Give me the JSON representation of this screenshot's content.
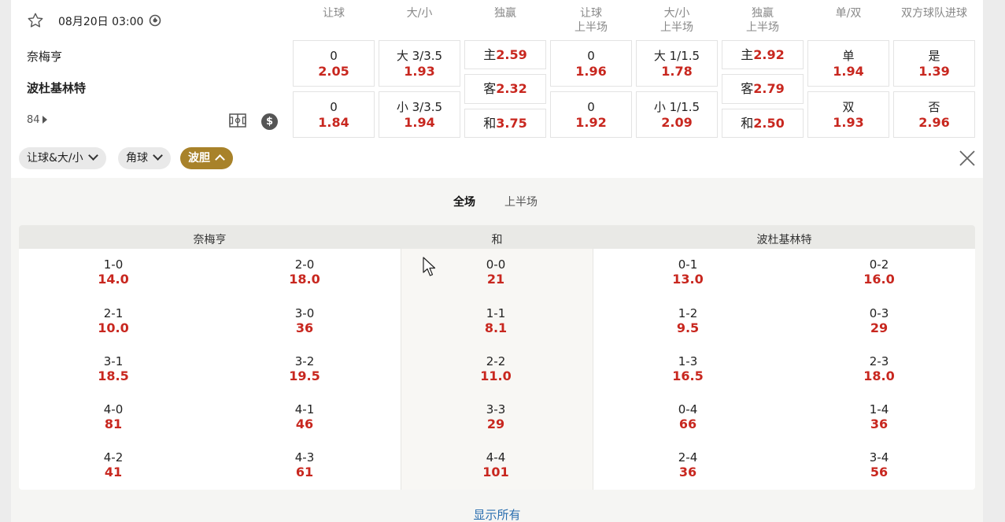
{
  "match": {
    "datetime": "08月20日 03:00",
    "home": "奈梅亨",
    "away": "波杜基林特",
    "minute": "84"
  },
  "market_headers": [
    {
      "line1": "让球",
      "line2": ""
    },
    {
      "line1": "大/小",
      "line2": ""
    },
    {
      "line1": "独赢",
      "line2": ""
    },
    {
      "line1": "让球",
      "line2": "上半场"
    },
    {
      "line1": "大/小",
      "line2": "上半场"
    },
    {
      "line1": "独赢",
      "line2": "上半场"
    },
    {
      "line1": "单/双",
      "line2": ""
    },
    {
      "line1": "双方球队进球",
      "line2": ""
    }
  ],
  "markets": {
    "handicap": [
      {
        "line": "0",
        "odds": "2.05"
      },
      {
        "line": "0",
        "odds": "1.84"
      }
    ],
    "over_under": [
      {
        "line": "大 3/3.5",
        "odds": "1.93"
      },
      {
        "line": "小 3/3.5",
        "odds": "1.94"
      }
    ],
    "win": [
      {
        "label": "主",
        "odds": "2.59"
      },
      {
        "label": "客",
        "odds": "2.32"
      },
      {
        "label": "和",
        "odds": "3.75"
      }
    ],
    "handicap_1h": [
      {
        "line": "0",
        "odds": "1.96"
      },
      {
        "line": "0",
        "odds": "1.92"
      }
    ],
    "over_under_1h": [
      {
        "line": "大 1/1.5",
        "odds": "1.78"
      },
      {
        "line": "小 1/1.5",
        "odds": "2.09"
      }
    ],
    "win_1h": [
      {
        "label": "主",
        "odds": "2.92"
      },
      {
        "label": "客",
        "odds": "2.79"
      },
      {
        "label": "和",
        "odds": "2.50"
      }
    ],
    "odd_even": [
      {
        "label": "单",
        "odds": "1.94"
      },
      {
        "label": "双",
        "odds": "1.93"
      }
    ],
    "btts": [
      {
        "label": "是",
        "odds": "1.39"
      },
      {
        "label": "否",
        "odds": "2.96"
      }
    ]
  },
  "filters": [
    {
      "label": "让球&大/小",
      "active": false
    },
    {
      "label": "角球",
      "active": false
    },
    {
      "label": "波胆",
      "active": true
    }
  ],
  "period_tabs": [
    {
      "label": "全场",
      "active": true
    },
    {
      "label": "上半场",
      "active": false
    }
  ],
  "correct_score": {
    "columns": [
      "奈梅亨",
      "和",
      "波杜基林特"
    ],
    "home": [
      [
        {
          "score": "1-0",
          "odds": "14.0"
        },
        {
          "score": "2-0",
          "odds": "18.0"
        }
      ],
      [
        {
          "score": "2-1",
          "odds": "10.0"
        },
        {
          "score": "3-0",
          "odds": "36"
        }
      ],
      [
        {
          "score": "3-1",
          "odds": "18.5"
        },
        {
          "score": "3-2",
          "odds": "19.5"
        }
      ],
      [
        {
          "score": "4-0",
          "odds": "81"
        },
        {
          "score": "4-1",
          "odds": "46"
        }
      ],
      [
        {
          "score": "4-2",
          "odds": "41"
        },
        {
          "score": "4-3",
          "odds": "61"
        }
      ]
    ],
    "draw": [
      {
        "score": "0-0",
        "odds": "21"
      },
      {
        "score": "1-1",
        "odds": "8.1"
      },
      {
        "score": "2-2",
        "odds": "11.0"
      },
      {
        "score": "3-3",
        "odds": "29"
      },
      {
        "score": "4-4",
        "odds": "101"
      }
    ],
    "away": [
      [
        {
          "score": "0-1",
          "odds": "13.0"
        },
        {
          "score": "0-2",
          "odds": "16.0"
        }
      ],
      [
        {
          "score": "1-2",
          "odds": "9.5"
        },
        {
          "score": "0-3",
          "odds": "29"
        }
      ],
      [
        {
          "score": "1-3",
          "odds": "16.5"
        },
        {
          "score": "2-3",
          "odds": "18.0"
        }
      ],
      [
        {
          "score": "0-4",
          "odds": "66"
        },
        {
          "score": "1-4",
          "odds": "36"
        }
      ],
      [
        {
          "score": "2-4",
          "odds": "36"
        },
        {
          "score": "3-4",
          "odds": "56"
        }
      ]
    ]
  },
  "show_all": "显示所有",
  "icons": {
    "favorite": "star-icon",
    "clock": "clock-icon",
    "pitch": "pitch-icon",
    "money": "dollar-icon",
    "close": "close-icon"
  },
  "colors": {
    "odds": "#c8271f",
    "active_filter": "#a8822a",
    "link": "#2a6fb0"
  }
}
